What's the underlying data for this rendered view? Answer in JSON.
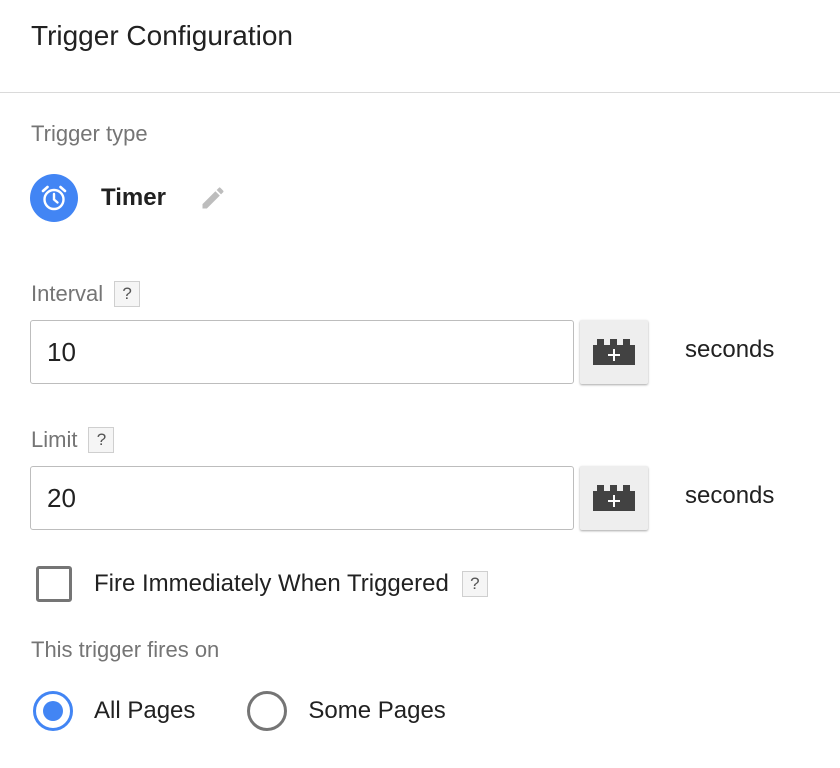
{
  "header": {
    "title": "Trigger Configuration"
  },
  "trigger_type": {
    "label": "Trigger type",
    "name": "Timer",
    "icon": "clock-icon",
    "edit_icon": "pencil-icon",
    "accent_color": "#4285f4"
  },
  "interval": {
    "label": "Interval",
    "help": "?",
    "value": "10",
    "variable_icon": "variable-block-icon",
    "unit": "seconds"
  },
  "limit": {
    "label": "Limit",
    "help": "?",
    "value": "20",
    "variable_icon": "variable-block-icon",
    "unit": "seconds"
  },
  "fire_immediately": {
    "label": "Fire Immediately When Triggered",
    "help": "?",
    "checked": false
  },
  "fires_on": {
    "label": "This trigger fires on",
    "options": [
      {
        "label": "All Pages",
        "selected": true
      },
      {
        "label": "Some Pages",
        "selected": false
      }
    ]
  }
}
